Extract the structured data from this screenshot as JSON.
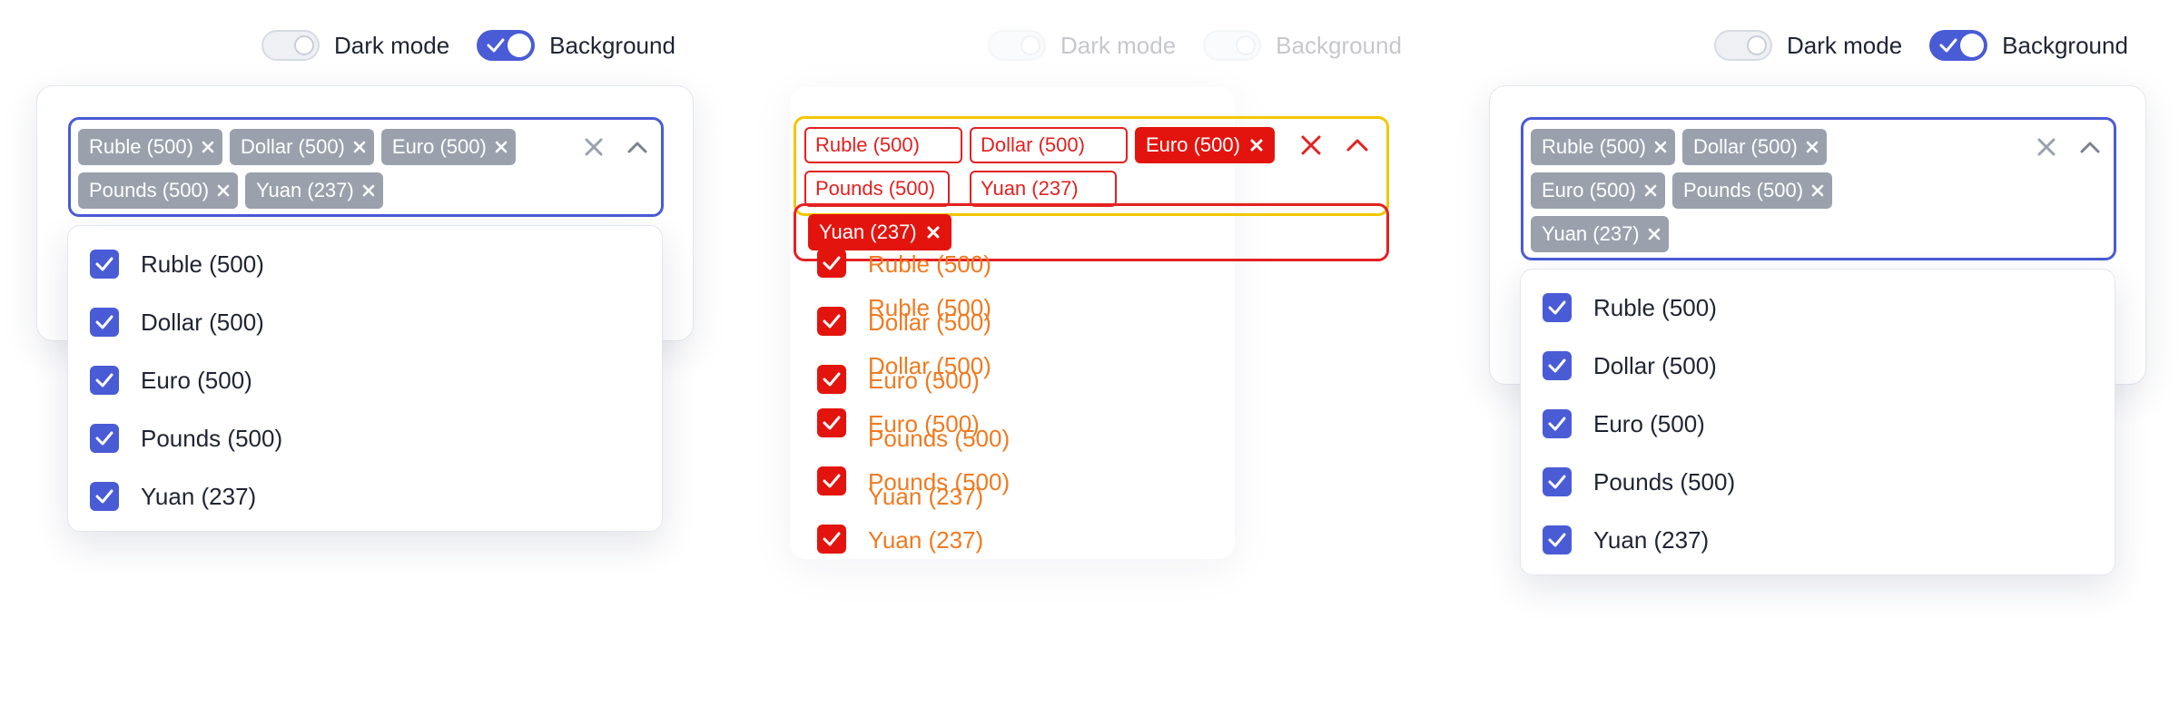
{
  "controls": {
    "dark_mode_label": "Dark mode",
    "background_label": "Background"
  },
  "colors": {
    "accent": "#4a5bd6",
    "tag_bg": "#9aa1ad",
    "debug_red": "#e3140e",
    "debug_orange": "#f07a20"
  },
  "icons": {
    "tag_remove": "close-icon",
    "clear": "close-icon",
    "toggle_dropdown": "chevron-up-icon",
    "checkbox": "check-icon"
  },
  "selected_tags": [
    {
      "label": "Ruble (500)"
    },
    {
      "label": "Dollar (500)"
    },
    {
      "label": "Euro (500)"
    },
    {
      "label": "Pounds (500)"
    },
    {
      "label": "Yuan (237)"
    }
  ],
  "options": [
    {
      "label": "Ruble (500)",
      "checked": true
    },
    {
      "label": "Dollar (500)",
      "checked": true
    },
    {
      "label": "Euro (500)",
      "checked": true
    },
    {
      "label": "Pounds (500)",
      "checked": true
    },
    {
      "label": "Yuan (237)",
      "checked": true
    }
  ],
  "diff": {
    "tags": [
      "Ruble (500)",
      "Dollar (500)",
      "Euro (500)",
      "Pounds (500)",
      "Yuan (237)"
    ],
    "options": [
      "Ruble (500)",
      "Dollar (500)",
      "Euro (500)",
      "Pounds (500)",
      "Yuan (237)"
    ]
  }
}
